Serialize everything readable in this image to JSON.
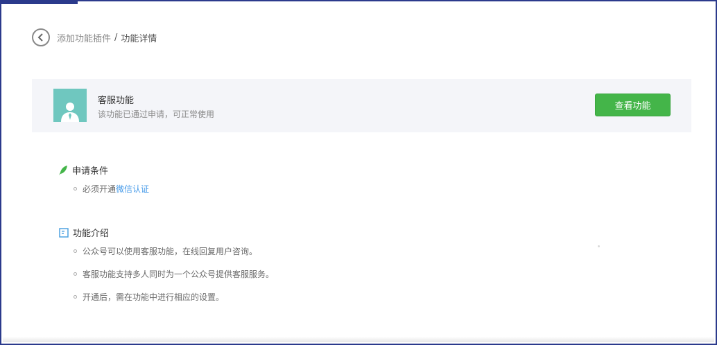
{
  "breadcrumb": {
    "parent": "添加功能插件",
    "separator": "/",
    "current": "功能详情"
  },
  "feature": {
    "name": "客服功能",
    "status": "该功能已通过申请，可正常使用",
    "view_button": "查看功能",
    "accent_color": "#44b549",
    "avatar_color": "#6fc7bf"
  },
  "requirements": {
    "heading": "申请条件",
    "items": [
      {
        "prefix": "必须开通",
        "link": "微信认证"
      }
    ]
  },
  "intro": {
    "heading": "功能介绍",
    "items": [
      "公众号可以使用客服功能，在线回复用户咨询。",
      "客服功能支持多人同时为一个公众号提供客服服务。",
      "开通后，需在功能中进行相应的设置。"
    ]
  }
}
